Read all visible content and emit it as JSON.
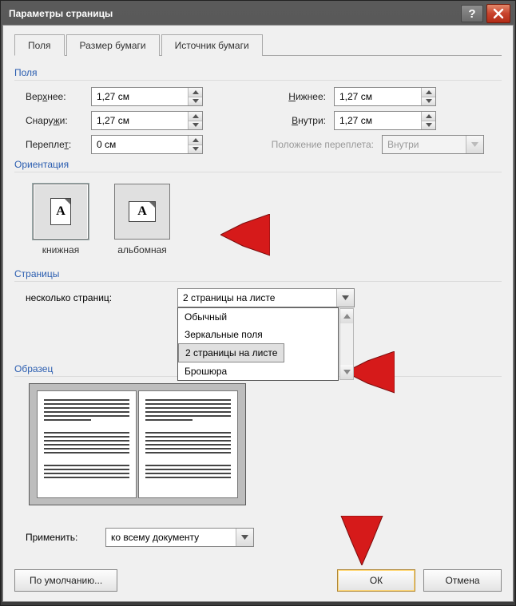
{
  "window": {
    "title": "Параметры страницы"
  },
  "tabs": {
    "margins": "Поля",
    "paper": "Размер бумаги",
    "source": "Источник бумаги"
  },
  "groups": {
    "margins": "Поля",
    "orientation": "Ориентация",
    "pages": "Страницы",
    "preview": "Образец"
  },
  "margins": {
    "top_label": "Верхнее:",
    "top_value": "1,27 см",
    "bottom_label": "Нижнее:",
    "bottom_value": "1,27 см",
    "outside_label": "Снаружи:",
    "outside_value": "1,27 см",
    "inside_label": "Внутри:",
    "inside_value": "1,27 см",
    "gutter_label": "Переплет:",
    "gutter_value": "0 см",
    "gutter_pos_label": "Положение переплета:",
    "gutter_pos_value": "Внутри"
  },
  "orientation": {
    "portrait": "книжная",
    "landscape": "альбомная"
  },
  "pages": {
    "multi_label": "несколько страниц:",
    "selected": "2 страницы на листе",
    "options": [
      "Обычный",
      "Зеркальные поля",
      "2 страницы на листе",
      "Брошюра"
    ]
  },
  "apply": {
    "label": "Применить:",
    "value": "ко всему документу"
  },
  "buttons": {
    "default": "По умолчанию...",
    "ok": "ОК",
    "cancel": "Отмена"
  }
}
